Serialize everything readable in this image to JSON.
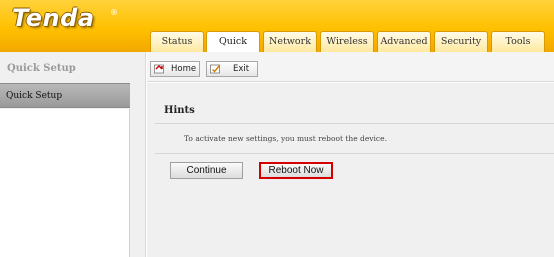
{
  "header": {
    "logo_text": "Tenda",
    "logo_mark": "®",
    "tabs": [
      {
        "label": "Status"
      },
      {
        "label": "Quick Setup"
      },
      {
        "label": "Network"
      },
      {
        "label": "Wireless"
      },
      {
        "label": "Advanced"
      },
      {
        "label": "Security"
      },
      {
        "label": "Tools"
      }
    ],
    "active_tab": "Quick Setup"
  },
  "sidebar": {
    "title": "Quick Setup",
    "items": [
      {
        "label": "Quick Setup"
      }
    ]
  },
  "toolbar": {
    "home_label": "Home",
    "home_icon": "home-icon",
    "exit_label": "Exit",
    "exit_icon": "exit-icon"
  },
  "main": {
    "hints_title": "Hints",
    "hints_text": "To activate new settings, you must reboot the device.",
    "continue_label": "Continue",
    "reboot_label": "Reboot Now"
  },
  "colors": {
    "header_yellow": "#ffc000",
    "highlight_red": "#d40000"
  }
}
